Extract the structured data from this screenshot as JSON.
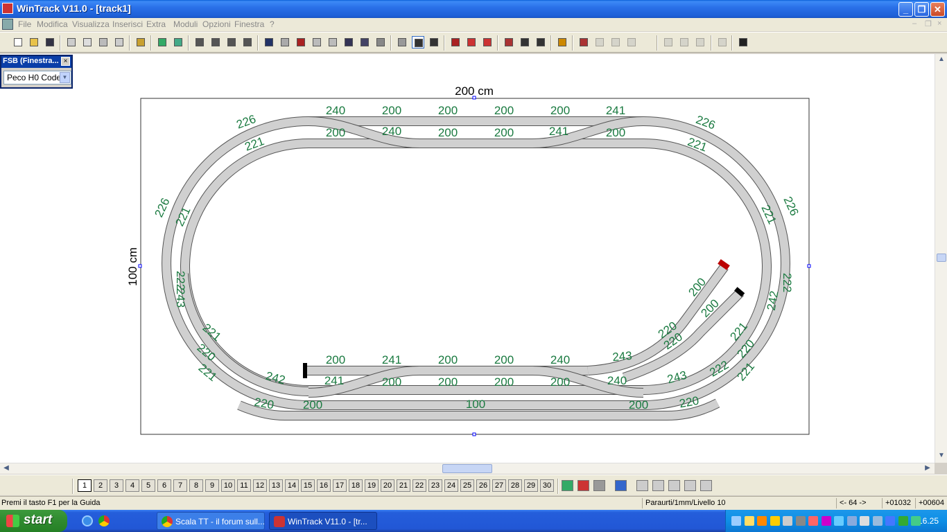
{
  "window": {
    "title": "WinTrack  V11.0 - [track1]",
    "controls": {
      "minimize": "_",
      "maximize": "❐",
      "close": "✕"
    }
  },
  "menubar": {
    "items": [
      "File",
      "Modifica",
      "Visualizza",
      "Inserisci",
      "Extra",
      "Moduli",
      "Opzioni",
      "Finestra",
      "?"
    ],
    "mdi_controls": [
      "–",
      "❐",
      "×"
    ]
  },
  "toolbar": {
    "icons": [
      "new-icon",
      "open-icon",
      "save-icon",
      "print-preview-icon",
      "print-icon",
      "print-setup-icon",
      "calc-icon",
      "library-icon",
      "grid-icon",
      "picture-icon",
      "zoom-out-icon",
      "zoom-in-icon",
      "zoom-window-icon",
      "zoom-all-icon",
      "undo-icon",
      "redo-icon",
      "list-icon",
      "copy-page-icon",
      "paste-page-icon",
      "cut-icon",
      "copy-icon",
      "paste-icon",
      "switch-icon",
      "curve-icon",
      "flex-icon",
      "section-icon",
      "red-layer-icon",
      "red-blocks-icon",
      "move-icon",
      "rotate-icon",
      "rotate180-icon",
      "light-icon",
      "connect-icon",
      "split-icon",
      "join-icon",
      "extend-icon",
      "align1-icon",
      "align2-icon",
      "align3-icon",
      "settings-icon",
      "help-icon"
    ]
  },
  "fsb": {
    "title": "FSB (Finestra...",
    "close": "×",
    "selected_library": "Peco H0 Code"
  },
  "plan": {
    "width_label": "200 cm",
    "height_label": "100 cm",
    "labels": {
      "top_outer": [
        "240",
        "200",
        "200",
        "200",
        "200",
        "241"
      ],
      "top_inner": [
        "200",
        "240",
        "200",
        "200",
        "241",
        "200"
      ],
      "bottom_upper": [
        "200",
        "241",
        "200",
        "200",
        "240"
      ],
      "bottom_middle": [
        "241",
        "200",
        "200",
        "200",
        "200",
        "240"
      ],
      "bottom_lower": [
        "200",
        "100",
        "200"
      ],
      "curves_left": [
        "226",
        "221",
        "226",
        "221",
        "222",
        "243",
        "221",
        "220",
        "221",
        "242",
        "220"
      ],
      "curves_right": [
        "226",
        "221",
        "226",
        "221",
        "222",
        "242",
        "221",
        "220",
        "221",
        "222",
        "243",
        "220"
      ],
      "branch": [
        "200",
        "200",
        "220",
        "220",
        "243"
      ]
    }
  },
  "layers": {
    "buttons": [
      "1",
      "2",
      "3",
      "4",
      "5",
      "6",
      "7",
      "8",
      "9",
      "10",
      "11",
      "12",
      "13",
      "14",
      "15",
      "16",
      "17",
      "18",
      "19",
      "20",
      "21",
      "22",
      "23",
      "24",
      "25",
      "26",
      "27",
      "28",
      "29",
      "30"
    ],
    "active": "1"
  },
  "status": {
    "help": "Premi il tasto F1 per la Guida",
    "info": "Paraurti/1mm/Livello 10",
    "nav": "<- 64 ->",
    "x": "+01032",
    "y": "+00604"
  },
  "taskbar": {
    "start": "start",
    "tasks": [
      "Scala TT - il forum sull...",
      "WinTrack  V11.0 - [tr..."
    ],
    "clock": "16.25"
  },
  "colors": {
    "track_fill": "#d0d0d0",
    "track_stroke": "#555555",
    "label_green": "#1a7a40",
    "title_blue": "#0a5fd8"
  }
}
